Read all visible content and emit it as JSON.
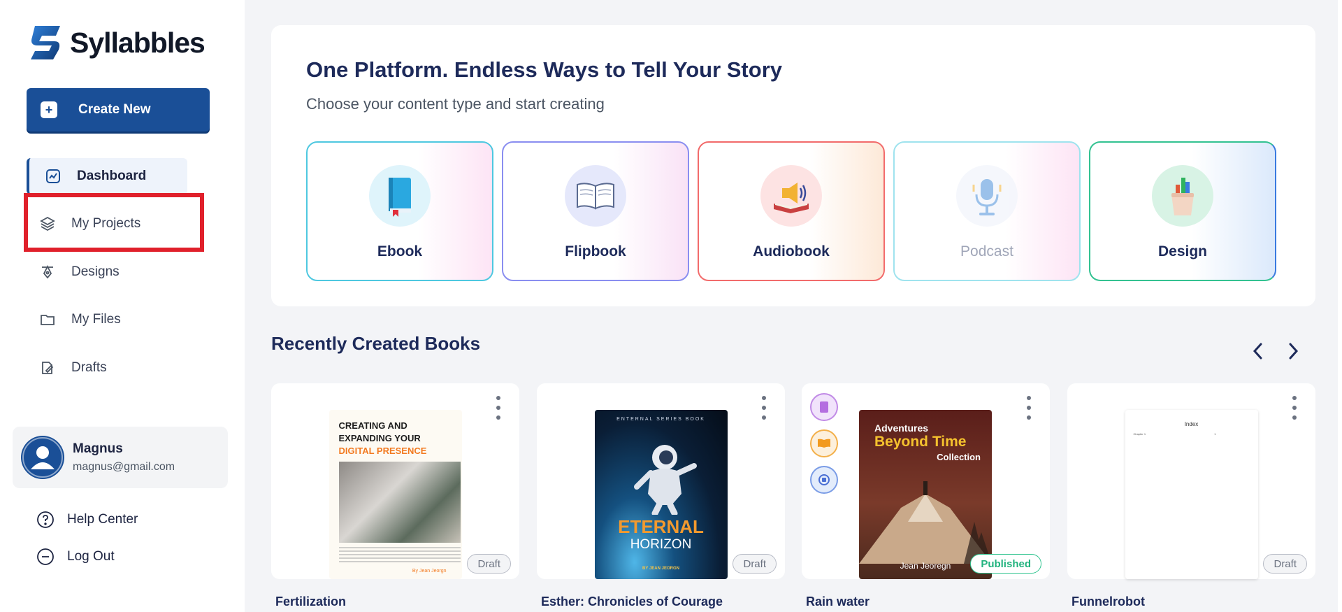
{
  "app": {
    "name": "Syllabbles"
  },
  "sidebar": {
    "create_label": "Create New",
    "nav": [
      {
        "label": "Dashboard",
        "icon": "dashboard-icon",
        "active": true
      },
      {
        "label": "My Projects",
        "icon": "layers-icon",
        "active": false
      },
      {
        "label": "Designs",
        "icon": "pen-tool-icon",
        "active": false
      },
      {
        "label": "My Files",
        "icon": "folder-icon",
        "active": false
      },
      {
        "label": "Drafts",
        "icon": "drafts-icon",
        "active": false
      }
    ],
    "user": {
      "name": "Magnus",
      "email": "magnus@gmail.com"
    },
    "help_label": "Help Center",
    "logout_label": "Log Out"
  },
  "hero": {
    "title": "One Platform. Endless Ways to Tell Your Story",
    "subtitle": "Choose your content type and start creating",
    "types": [
      {
        "label": "Ebook",
        "icon": "ebook-icon",
        "enabled": true
      },
      {
        "label": "Flipbook",
        "icon": "open-book-icon",
        "enabled": true
      },
      {
        "label": "Audiobook",
        "icon": "audiobook-icon",
        "enabled": true
      },
      {
        "label": "Podcast",
        "icon": "microphone-icon",
        "enabled": false
      },
      {
        "label": "Design",
        "icon": "design-cup-icon",
        "enabled": true
      }
    ]
  },
  "recent": {
    "title": "Recently Created Books",
    "books": [
      {
        "title": "Fertilization",
        "status": "Draft",
        "cover": {
          "line1": "CREATING AND",
          "line2": "EXPANDING YOUR",
          "line3": "DIGITAL PRESENCE",
          "author": "By Jean Jeorgn"
        }
      },
      {
        "title": "Esther: Chronicles of Courage",
        "status": "Draft",
        "cover": {
          "series": "ENTERNAL SERIES BOOK",
          "word1": "ETERNAL",
          "word2": "HORIZON",
          "author": "BY JEAN JEORGN"
        }
      },
      {
        "title": "Rain water",
        "status": "Published",
        "cover": {
          "line1": "Adventures",
          "line2": "Beyond Time",
          "line3": "Collection",
          "author": "Jean Jeoregn"
        }
      },
      {
        "title": "Funnelrobot",
        "status": "Draft",
        "cover": {
          "heading": "Index",
          "entry": "Chapter 1",
          "page": "1"
        }
      }
    ]
  },
  "colors": {
    "primary": "#1a4f97",
    "heading": "#1d2a5a",
    "published": "#21b37e",
    "highlight": "#e0202b"
  }
}
